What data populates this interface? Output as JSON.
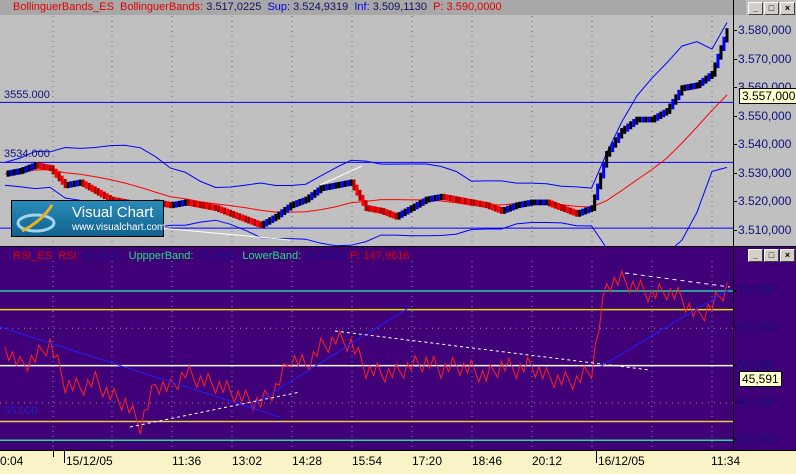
{
  "price_panel": {
    "indicator_name": "BollinguerBands_ES",
    "label": "BollinguerBands:",
    "value": "3.517,0225",
    "sup_label": "Sup:",
    "sup_value": "3.524,9319",
    "inf_label": "Inf:",
    "inf_value": "3.509,1130",
    "p_label": "P:",
    "p_value": "3.590,0000",
    "axis_ticks": [
      "3.580,000",
      "3.570,000",
      "3.560,000",
      "3.550,000",
      "3.540,000",
      "3.530,000",
      "3.520,000",
      "3.510,000"
    ],
    "current_value": "3.557,000",
    "level_lines": [
      "3555.000",
      "3534.000"
    ]
  },
  "logo": {
    "name": "Visual Chart",
    "url": "www.visualchart.com"
  },
  "rsi_panel": {
    "indicator_name": "RSI_ES",
    "label": "RSI:",
    "value": "56,9013",
    "upper_label": "UppperBand:",
    "upper_value": "70,0000",
    "lower_label": "LowerBand:",
    "lower_value": "30,0000",
    "p_label": "P:",
    "p_value": "147,9616",
    "axis_ticks": [
      "70,000",
      "60,000",
      "50,000",
      "40,000",
      "30,000"
    ],
    "current_value": "45,591",
    "level_line": "35.000"
  },
  "time_axis": [
    "0:04",
    "15/12/05",
    "11:36",
    "13:02",
    "14:28",
    "15:54",
    "17:20",
    "18:46",
    "20:12",
    "16/12/05",
    "11:34"
  ],
  "window_buttons": [
    "_",
    "□",
    "×"
  ],
  "colors": {
    "price_bg": "#c0c0c0",
    "rsi_bg": "#400078",
    "band": "#0000ff",
    "ma": "#ff0000"
  },
  "chart_data": {
    "type": "line",
    "price_closes": [
      3530,
      3531,
      3533,
      3532,
      3526,
      3527,
      3524,
      3521,
      3520,
      3519,
      3520,
      3519,
      3520,
      3519,
      3518,
      3516,
      3514,
      3512,
      3515,
      3519,
      3521,
      3525,
      3526,
      3527,
      3518,
      3517,
      3515,
      3518,
      3521,
      3522,
      3521,
      3520,
      3519,
      3517,
      3519,
      3520,
      3520,
      3518,
      3516,
      3518,
      3537,
      3545,
      3549,
      3549,
      3552,
      3560,
      3561,
      3565,
      3580
    ],
    "rsi": [
      55,
      50,
      52,
      56,
      45,
      44,
      46,
      42,
      40,
      34,
      45,
      44,
      48,
      46,
      45,
      43,
      41,
      40,
      44,
      52,
      50,
      55,
      57,
      56,
      49,
      48,
      48,
      50,
      51,
      49,
      50,
      49,
      47,
      50,
      49,
      50,
      47,
      46,
      46,
      49,
      72,
      73,
      71,
      69,
      70,
      68,
      63,
      66,
      71
    ],
    "price_ylim": [
      3505,
      3590
    ],
    "rsi_ylim": [
      25,
      75
    ],
    "rsi_levels": [
      70,
      65,
      50,
      35,
      30
    ]
  }
}
